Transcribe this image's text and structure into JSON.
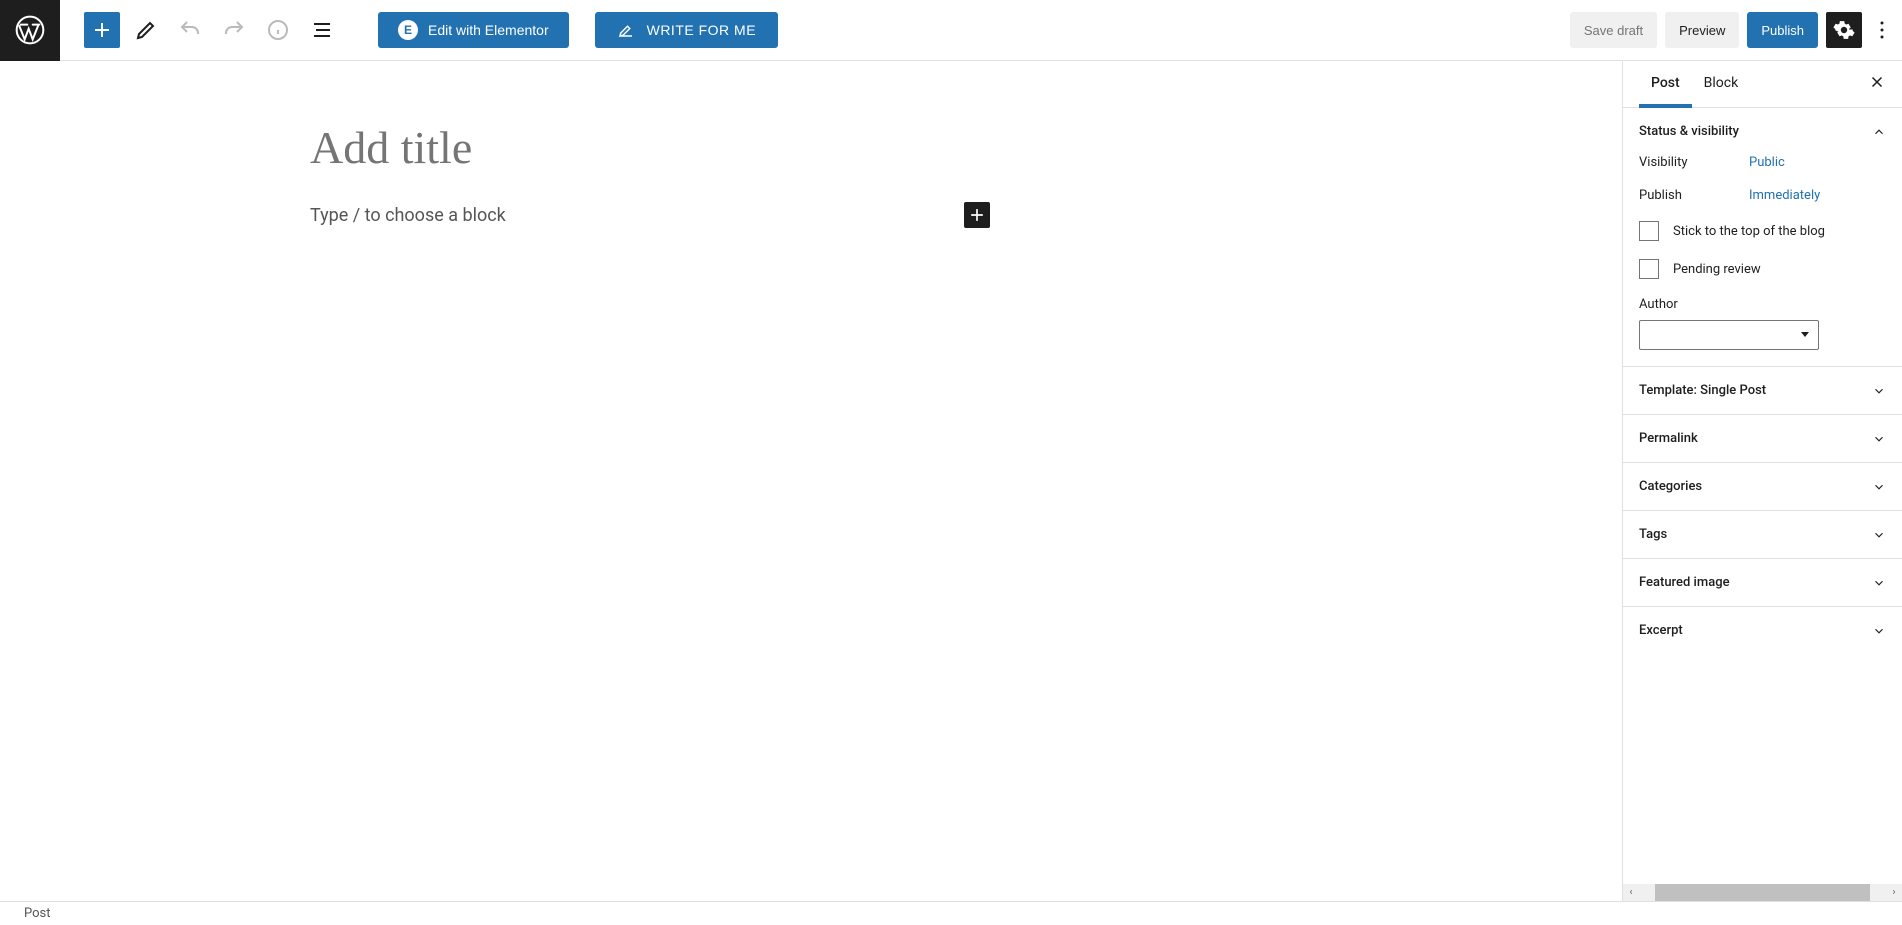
{
  "toolbar": {
    "elementor_label": "Edit with Elementor",
    "write_for_me_label": "WRITE FOR ME",
    "save_draft_label": "Save draft",
    "preview_label": "Preview",
    "publish_label": "Publish"
  },
  "editor": {
    "title_placeholder": "Add title",
    "block_placeholder": "Type / to choose a block"
  },
  "sidebar": {
    "tabs": {
      "post": "Post",
      "block": "Block"
    },
    "panels": {
      "status": {
        "title": "Status & visibility",
        "visibility_label": "Visibility",
        "visibility_value": "Public",
        "publish_label": "Publish",
        "publish_value": "Immediately",
        "stick_label": "Stick to the top of the blog",
        "pending_label": "Pending review",
        "author_label": "Author",
        "author_value": ""
      },
      "template": "Template: Single Post",
      "permalink": "Permalink",
      "categories": "Categories",
      "tags": "Tags",
      "featured_image": "Featured image",
      "excerpt": "Excerpt"
    }
  },
  "statusbar": {
    "breadcrumb": "Post"
  }
}
